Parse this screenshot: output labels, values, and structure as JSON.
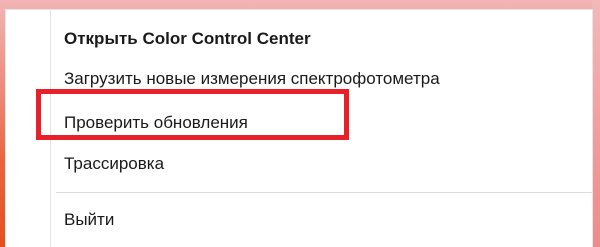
{
  "menu": {
    "items": [
      {
        "label": "Открыть Color Control Center",
        "bold": true
      },
      {
        "label": "Загрузить новые измерения спектрофотометра",
        "bold": false
      },
      {
        "label": "Проверить обновления",
        "bold": false
      },
      {
        "label": "Трассировка",
        "bold": false
      },
      {
        "label": "Выйти",
        "bold": false
      }
    ]
  },
  "highlight": {
    "target": "Проверить обновления",
    "color": "#e8202a"
  },
  "colors": {
    "frame": "#e8663f",
    "menu_bg": "#ffffff",
    "text": "#1a1a1a"
  }
}
